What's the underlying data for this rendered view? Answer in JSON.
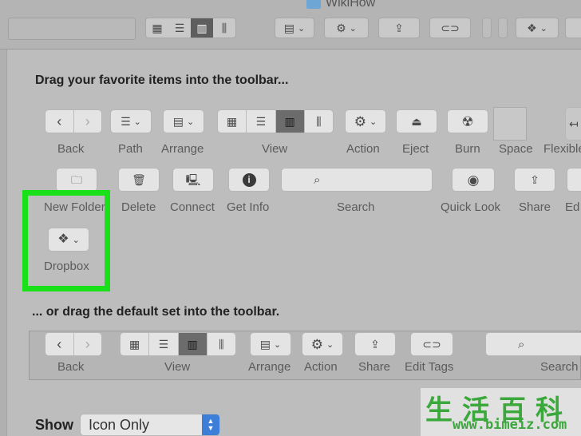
{
  "window": {
    "title": "WikiHow"
  },
  "sheet": {
    "heading": "Drag your favorite items into the toolbar...",
    "items_row1": {
      "back": "Back",
      "path": "Path",
      "arrange": "Arrange",
      "view": "View",
      "action": "Action",
      "eject": "Eject",
      "burn": "Burn",
      "space": "Space",
      "flexible_space": "Flexible"
    },
    "items_row2": {
      "new_folder": "New Folder",
      "delete": "Delete",
      "connect": "Connect",
      "get_info": "Get Info",
      "search": "Search",
      "quick_look": "Quick Look",
      "share": "Share",
      "edit_tags": "Ed"
    },
    "highlighted": {
      "dropbox": "Dropbox",
      "highlight_color": "#19e019"
    },
    "default_heading": "... or drag the default set into the toolbar.",
    "default_set": {
      "back": "Back",
      "view": "View",
      "arrange": "Arrange",
      "action": "Action",
      "share": "Share",
      "edit_tags": "Edit Tags",
      "search": "Search"
    },
    "show": {
      "label": "Show",
      "value": "Icon Only"
    }
  },
  "watermark": {
    "chinese": "生活百科",
    "url": "www.bimeiz.com"
  }
}
